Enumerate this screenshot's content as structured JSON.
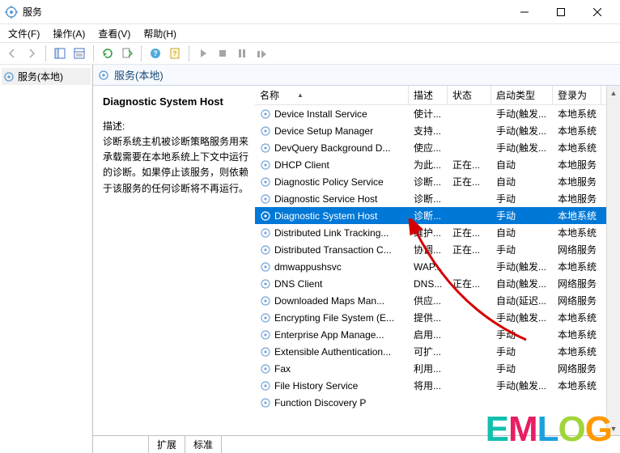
{
  "window": {
    "title": "服务",
    "minimize_tooltip": "Minimize",
    "maximize_tooltip": "Maximize",
    "close_tooltip": "Close"
  },
  "menu": {
    "file": "文件(F)",
    "action": "操作(A)",
    "view": "查看(V)",
    "help": "帮助(H)"
  },
  "nav": {
    "root": "服务(本地)"
  },
  "tab": {
    "header": "服务(本地)"
  },
  "detail": {
    "selected_name": "Diagnostic System Host",
    "desc_label": "描述:",
    "description": "诊断系统主机被诊断策略服务用来承载需要在本地系统上下文中运行的诊断。如果停止该服务，则依赖于该服务的任何诊断将不再运行。"
  },
  "columns": {
    "name": "名称",
    "desc": "描述",
    "status": "状态",
    "startup": "启动类型",
    "logon": "登录为"
  },
  "bottom_tabs": {
    "extended": "扩展",
    "standard": "标准"
  },
  "watermark": "EMLOG",
  "watermark_colors": [
    "#12bfae",
    "#e81e63",
    "#1da1dc",
    "#a0d53a",
    "#ff9800"
  ],
  "services": [
    {
      "name": "Device Install Service",
      "desc": "使计...",
      "status": "",
      "startup": "手动(触发...",
      "logon": "本地系统",
      "sel": false
    },
    {
      "name": "Device Setup Manager",
      "desc": "支持...",
      "status": "",
      "startup": "手动(触发...",
      "logon": "本地系统",
      "sel": false
    },
    {
      "name": "DevQuery Background D...",
      "desc": "使应...",
      "status": "",
      "startup": "手动(触发...",
      "logon": "本地系统",
      "sel": false
    },
    {
      "name": "DHCP Client",
      "desc": "为此...",
      "status": "正在...",
      "startup": "自动",
      "logon": "本地服务",
      "sel": false
    },
    {
      "name": "Diagnostic Policy Service",
      "desc": "诊断...",
      "status": "正在...",
      "startup": "自动",
      "logon": "本地服务",
      "sel": false
    },
    {
      "name": "Diagnostic Service Host",
      "desc": "诊断...",
      "status": "",
      "startup": "手动",
      "logon": "本地服务",
      "sel": false
    },
    {
      "name": "Diagnostic System Host",
      "desc": "诊断...",
      "status": "",
      "startup": "手动",
      "logon": "本地系统",
      "sel": true
    },
    {
      "name": "Distributed Link Tracking...",
      "desc": "维护...",
      "status": "正在...",
      "startup": "自动",
      "logon": "本地系统",
      "sel": false
    },
    {
      "name": "Distributed Transaction C...",
      "desc": "协调...",
      "status": "正在...",
      "startup": "手动",
      "logon": "网络服务",
      "sel": false
    },
    {
      "name": "dmwappushsvc",
      "desc": "WAP...",
      "status": "",
      "startup": "手动(触发...",
      "logon": "本地系统",
      "sel": false
    },
    {
      "name": "DNS Client",
      "desc": "DNS...",
      "status": "正在...",
      "startup": "自动(触发...",
      "logon": "网络服务",
      "sel": false
    },
    {
      "name": "Downloaded Maps Man...",
      "desc": "供应...",
      "status": "",
      "startup": "自动(延迟...",
      "logon": "网络服务",
      "sel": false
    },
    {
      "name": "Encrypting File System (E...",
      "desc": "提供...",
      "status": "",
      "startup": "手动(触发...",
      "logon": "本地系统",
      "sel": false
    },
    {
      "name": "Enterprise App Manage...",
      "desc": "启用...",
      "status": "",
      "startup": "手动",
      "logon": "本地系统",
      "sel": false
    },
    {
      "name": "Extensible Authentication...",
      "desc": "可扩...",
      "status": "",
      "startup": "手动",
      "logon": "本地系统",
      "sel": false
    },
    {
      "name": "Fax",
      "desc": "利用...",
      "status": "",
      "startup": "手动",
      "logon": "网络服务",
      "sel": false
    },
    {
      "name": "File History Service",
      "desc": "将用...",
      "status": "",
      "startup": "手动(触发...",
      "logon": "本地系统",
      "sel": false
    },
    {
      "name": "Function Discovery P",
      "desc": "",
      "status": "",
      "startup": "",
      "logon": "",
      "sel": false
    }
  ]
}
